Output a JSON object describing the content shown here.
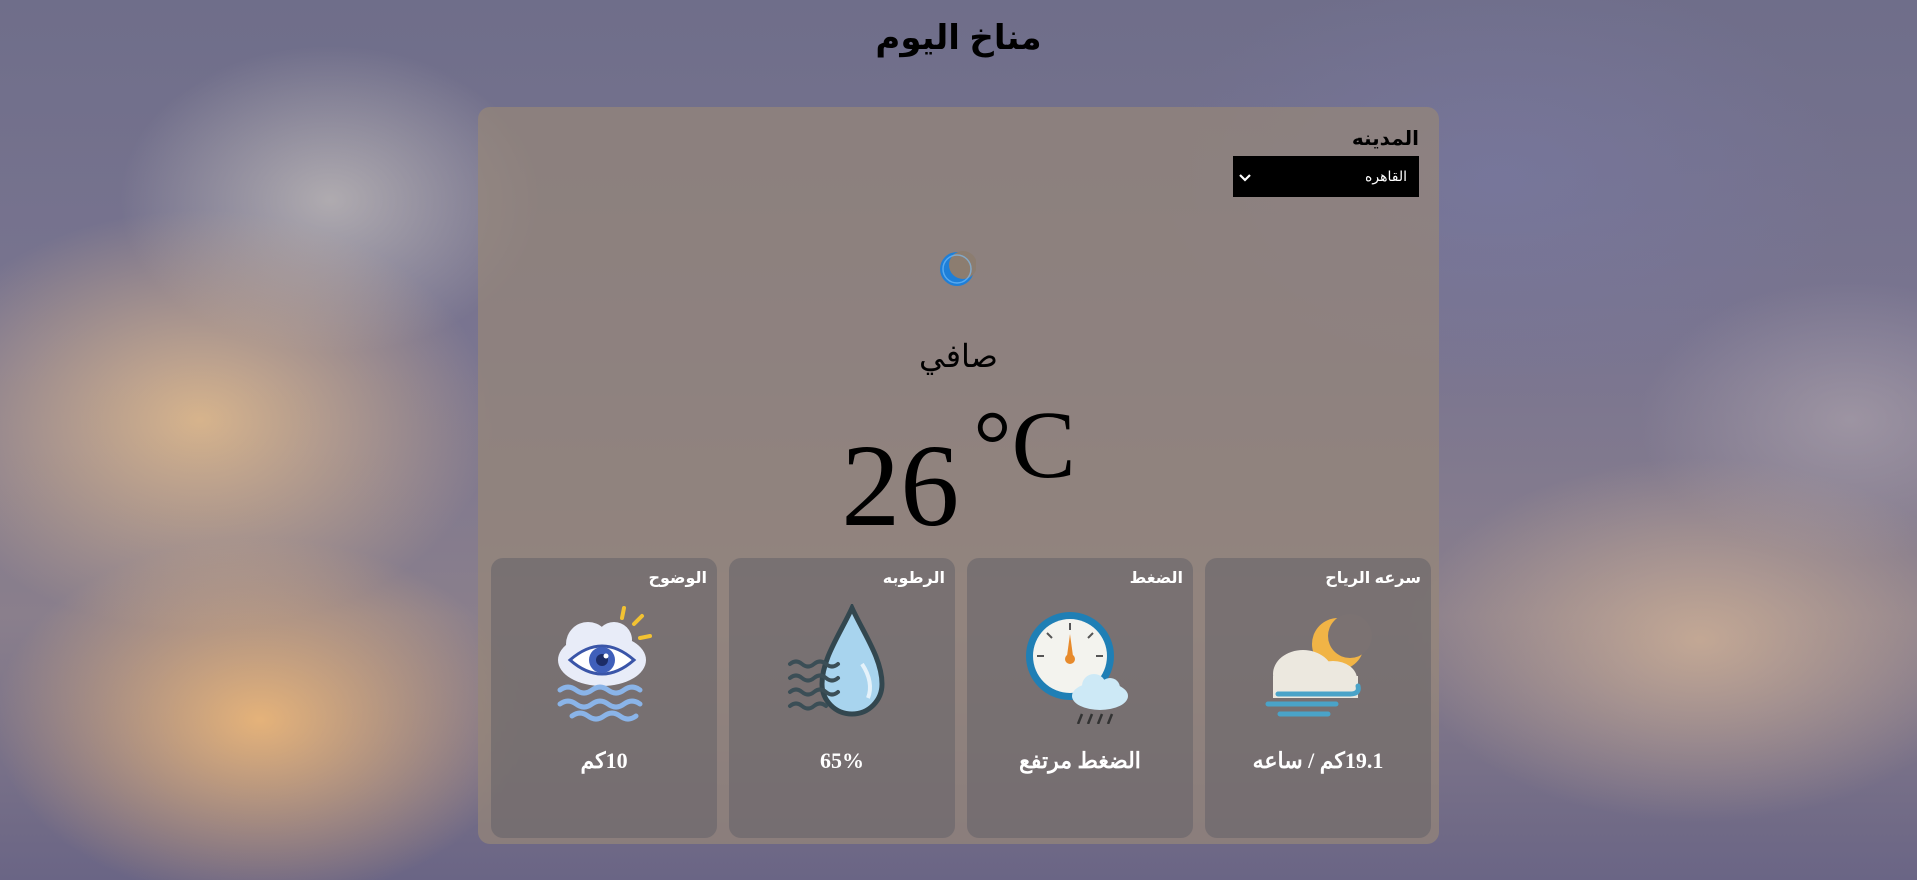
{
  "page_title": "مناخ اليوم",
  "city": {
    "label": "المدينه",
    "selected": "القاهره"
  },
  "weather": {
    "icon": "crescent-moon-icon",
    "condition": "صافي",
    "temperature": "26",
    "unit": "°C"
  },
  "tiles": [
    {
      "title": "سرعه الرياح",
      "value": "19.1كم / ساعه",
      "icon": "moon-cloud-wind-icon"
    },
    {
      "title": "الضغط",
      "value": "الضغط مرتفع",
      "icon": "barometer-rain-icon"
    },
    {
      "title": "الرطوبه",
      "value": "65%",
      "icon": "water-drop-icon"
    },
    {
      "title": "الوضوح",
      "value": "10كم",
      "icon": "eye-cloud-icon"
    }
  ],
  "colors": {
    "card": "#968778",
    "select_bg": "#000000",
    "moon": "#1e7fd8",
    "tile_text": "#ffffff"
  }
}
